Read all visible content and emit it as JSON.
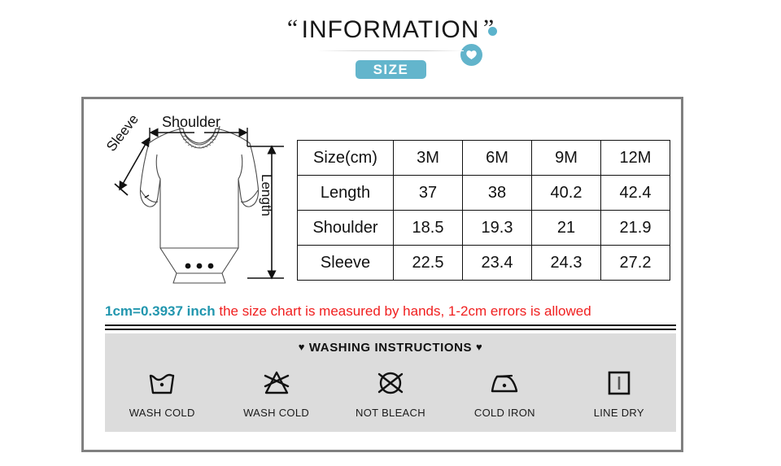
{
  "header": {
    "quote_left": "“",
    "title": "INFORMATION",
    "quote_right": "”",
    "badge_label": "SIZE",
    "accent_color": "#63b5cc",
    "bubble_icon": "chat-bubble-icon",
    "dot_icon": "dot-accent-icon"
  },
  "diagram": {
    "shoulder_label": "Shoulder",
    "sleeve_label": "Sleeve",
    "length_label": "Length",
    "garment": "baby-bodysuit-outline"
  },
  "table": {
    "columns": [
      "Size(cm)",
      "3M",
      "6M",
      "9M",
      "12M"
    ],
    "rows": [
      {
        "label": "Length",
        "values": [
          "37",
          "38",
          "40.2",
          "42.4"
        ]
      },
      {
        "label": "Shoulder",
        "values": [
          "18.5",
          "19.3",
          "21",
          "21.9"
        ]
      },
      {
        "label": "Sleeve",
        "values": [
          "22.5",
          "23.4",
          "24.3",
          "27.2"
        ]
      }
    ]
  },
  "note": {
    "conversion": "1cm=0.3937 inch",
    "conversion_color": "#2196ae",
    "disclaimer": " the size chart is measured by hands, 1-2cm errors is allowed",
    "disclaimer_color": "#f01e1e"
  },
  "washing": {
    "heart_left": "♥",
    "title": "WASHING INSTRUCTIONS",
    "heart_right": "♥",
    "panel_color": "#dcdcdc",
    "items": [
      {
        "icon": "wash-tub-icon",
        "caption": "WASH COLD"
      },
      {
        "icon": "no-bleach-triangle-icon",
        "caption": "WASH COLD"
      },
      {
        "icon": "no-dryclean-circle-icon",
        "caption": "NOT BLEACH"
      },
      {
        "icon": "iron-one-dot-icon",
        "caption": "COLD IRON"
      },
      {
        "icon": "line-dry-square-icon",
        "caption": "LINE DRY"
      }
    ]
  }
}
